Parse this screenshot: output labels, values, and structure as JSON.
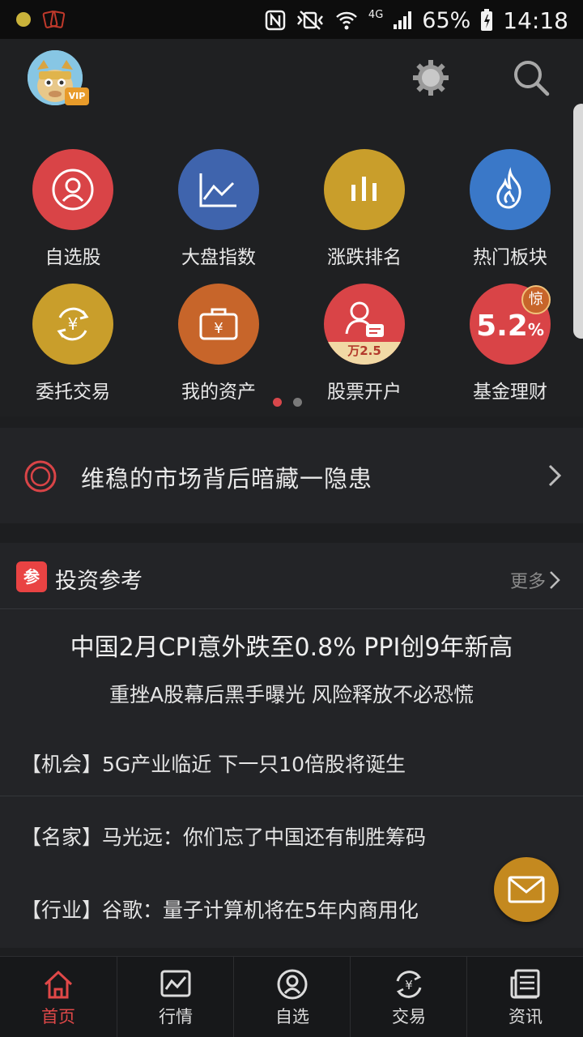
{
  "status_bar": {
    "network": "4G",
    "battery": "65%",
    "time": "14:18"
  },
  "header": {
    "vip_label": "VIP",
    "icons": [
      "avatar",
      "settings-gear-icon",
      "search-icon"
    ]
  },
  "grid": {
    "items": [
      {
        "label": "自选股",
        "icon": "person-icon",
        "color": "#d94447"
      },
      {
        "label": "大盘指数",
        "icon": "line-chart-icon",
        "color": "#3f64ad"
      },
      {
        "label": "涨跌排名",
        "icon": "bar-chart-icon",
        "color": "#c99e2b"
      },
      {
        "label": "热门板块",
        "icon": "flame-icon",
        "color": "#3a78c8"
      },
      {
        "label": "委托交易",
        "icon": "yuan-exchange-icon",
        "color": "#c99e2b"
      },
      {
        "label": "我的资产",
        "icon": "wallet-yuan-icon",
        "color": "#c7652a"
      },
      {
        "label": "股票开户",
        "icon": "account-open-icon",
        "color": "#d94447",
        "sub_text": "万2.5"
      },
      {
        "label": "基金理财",
        "icon": "fund-rate-icon",
        "color": "#d94447",
        "rate_text": "5.2",
        "rate_unit": "%",
        "badge_text": "惊"
      }
    ],
    "page_count": 2,
    "active_page": 1
  },
  "banner": {
    "text": "维稳的市场背后暗藏一隐患"
  },
  "reference": {
    "badge": "参",
    "title": "投资参考",
    "more_label": "更多",
    "headline": "中国2月CPI意外跌至0.8% PPI创9年新高",
    "subline": "重挫A股幕后黑手曝光 风险释放不必恐慌",
    "news": [
      "【机会】5G产业临近 下一只10倍股将诞生",
      "【名家】马光远：你们忘了中国还有制胜筹码",
      "【行业】谷歌：量子计算机将在5年内商用化"
    ]
  },
  "bottom_nav": {
    "items": [
      {
        "label": "首页",
        "icon": "home-icon"
      },
      {
        "label": "行情",
        "icon": "market-chart-icon"
      },
      {
        "label": "自选",
        "icon": "person-icon"
      },
      {
        "label": "交易",
        "icon": "yuan-exchange-icon"
      },
      {
        "label": "资讯",
        "icon": "news-icon"
      }
    ],
    "active": "首页"
  },
  "colors": {
    "accent_red": "#e04848",
    "gold": "#c4891f",
    "background": "#1d1e20"
  }
}
